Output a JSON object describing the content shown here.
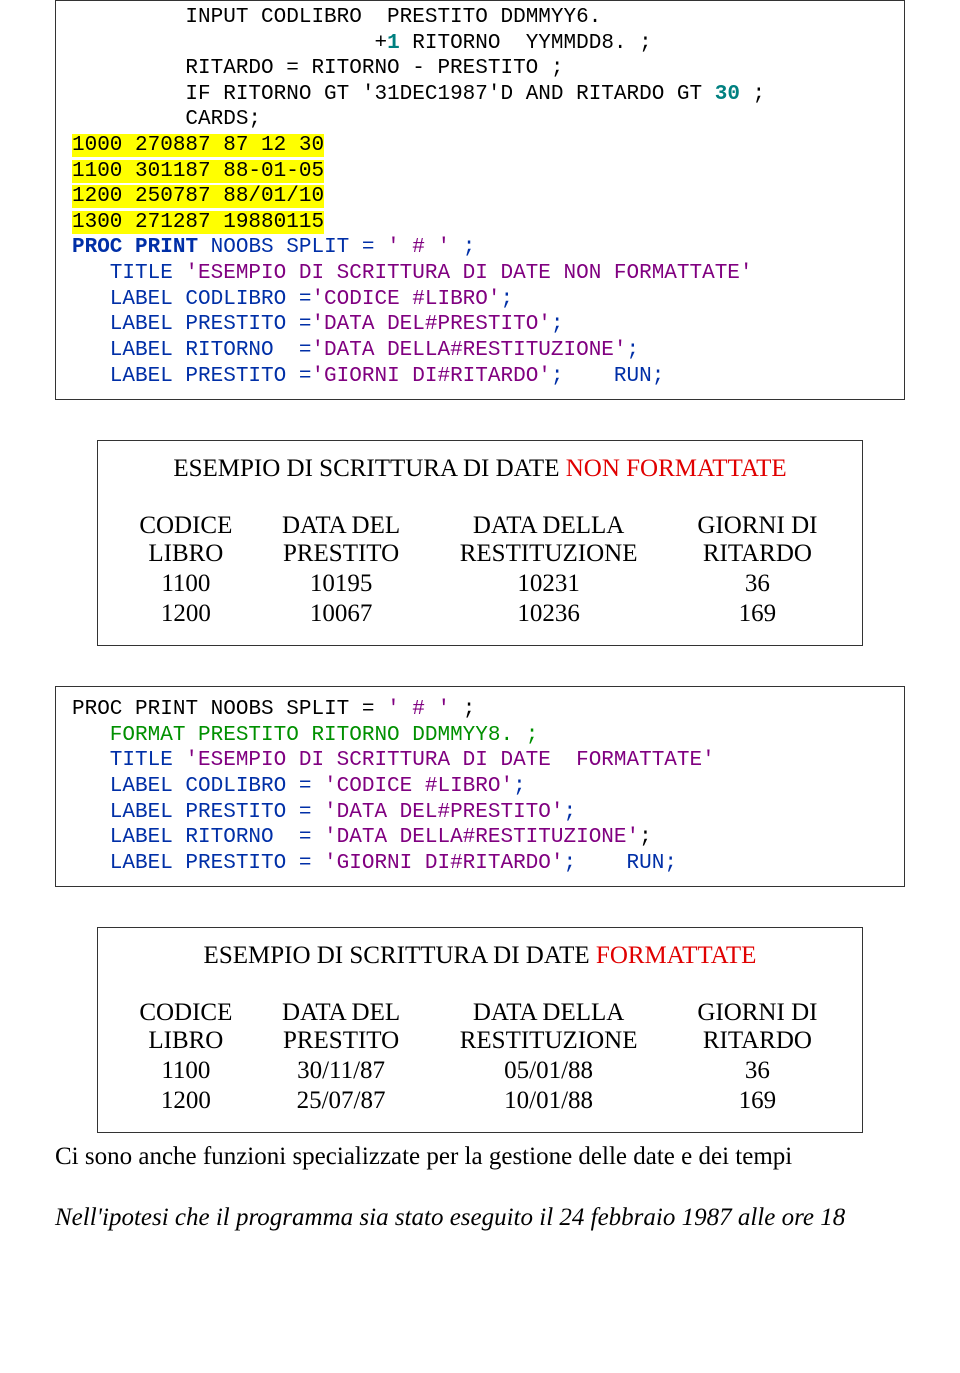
{
  "code1": {
    "l1a": "         INPUT CODLIBRO  PRESTITO ",
    "l1b": "DDMMYY6.",
    "l2a": "                        +",
    "l2b": "1",
    "l2c": " RITORNO  ",
    "l2d": "YYMMDD8.",
    "l2e": " ;",
    "l3": "         RITARDO = RITORNO - PRESTITO ;",
    "l4a": "         IF RITORNO GT ",
    "l4b": "'31DEC1987'D",
    "l4c": " AND RITARDO GT ",
    "l4d": "30",
    "l4e": " ;",
    "l5": "         CARDS;",
    "l6": "1000 270887 87 12 30",
    "l7": "1100 301187 88-01-05",
    "l8": "1200 250787 88/01/10",
    "l9": "1300 271287 19880115",
    "l10a": "PROC",
    "l10b": " ",
    "l10c": "PRINT",
    "l10d": " NOOBS SPLIT = ",
    "l10e": "' # '",
    "l10f": " ;",
    "l11a": "   TITLE ",
    "l11b": "'ESEMPIO DI SCRITTURA DI DATE NON FORMATTATE'",
    "l12a": "   LABEL CODLIBRO =",
    "l12b": "'CODICE #LIBRO'",
    "l12c": ";",
    "l13a": "   LABEL PRESTITO =",
    "l13b": "'DATA DEL#PRESTITO'",
    "l13c": ";",
    "l14a": "   LABEL RITORNO  =",
    "l14b": "'DATA DELLA#RESTITUZIONE'",
    "l14c": ";",
    "l15a": "   LABEL PRESTITO =",
    "l15b": "'GIORNI DI#RITARDO'",
    "l15c": ";    RUN;"
  },
  "out1": {
    "titleA": "ESEMPIO DI SCRITTURA DI DATE ",
    "titleB": "NON FORMATTATE",
    "h1a": "CODICE",
    "h1b": "LIBRO",
    "h2a": "DATA DEL",
    "h2b": "PRESTITO",
    "h3a": "DATA DELLA",
    "h3b": "RESTITUZIONE",
    "h4a": "GIORNI DI",
    "h4b": "RITARDO",
    "r1c1": "1100",
    "r1c2": "10195",
    "r1c3": "10231",
    "r1c4": "36",
    "r2c1": "1200",
    "r2c2": "10067",
    "r2c3": "10236",
    "r2c4": "169"
  },
  "code2": {
    "l1a": "PROC",
    "l1b": " ",
    "l1c": "PRINT",
    "l1d": " NOOBS SPLIT = ",
    "l1e": "' # '",
    "l1f": " ;",
    "l2a": "   FORMAT PRESTITO RITORNO ",
    "l2b": "DDMMYY8.",
    "l2c": " ;",
    "l3a": "   TITLE ",
    "l3b": "'ESEMPIO DI SCRITTURA DI DATE  FORMATTATE'",
    "l4a": "   LABEL CODLIBRO = ",
    "l4b": "'CODICE #LIBRO'",
    "l4c": ";",
    "l5a": "   LABEL PRESTITO = ",
    "l5b": "'DATA DEL#PRESTITO'",
    "l5c": ";",
    "l6a": "   LABEL RITORNO  = ",
    "l6b": "'DATA DELLA#RESTITUZIONE'",
    "l6c": ";",
    "l7a": "   LABEL PRESTITO = ",
    "l7b": "'GIORNI DI#RITARDO'",
    "l7c": ";    RUN;"
  },
  "out2": {
    "titleA": "ESEMPIO DI SCRITTURA DI DATE ",
    "titleB": "FORMATTATE",
    "h1a": "CODICE",
    "h1b": "LIBRO",
    "h2a": "DATA DEL",
    "h2b": "PRESTITO",
    "h3a": "DATA DELLA",
    "h3b": "RESTITUZIONE",
    "h4a": "GIORNI DI",
    "h4b": "RITARDO",
    "r1c1": "1100",
    "r1c2": "30/11/87",
    "r1c3": "05/01/88",
    "r1c4": "36",
    "r2c1": "1200",
    "r2c2": "25/07/87",
    "r2c3": "10/01/88",
    "r2c4": "169"
  },
  "foot1": "Ci sono anche funzioni specializzate per la gestione delle date e dei tempi",
  "foot2": "Nell'ipotesi che il programma sia stato eseguito il 24 febbraio 1987 alle ore 18"
}
